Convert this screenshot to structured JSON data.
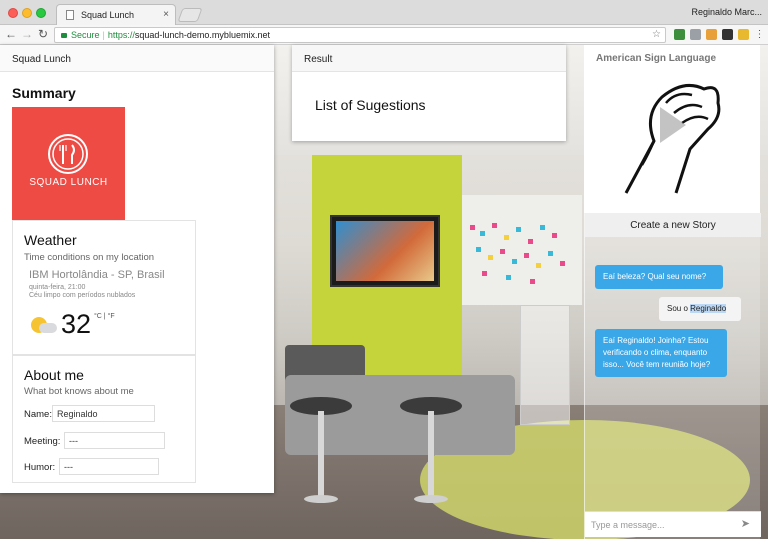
{
  "browser": {
    "tab_title": "Squad Lunch",
    "tab_close": "×",
    "profile_name": "Reginaldo Marc...",
    "secure_label": "Secure",
    "url_scheme": "https://",
    "url_host": "squad-lunch-demo.mybluemix.net",
    "back": "←",
    "forward": "→",
    "reload": "↻",
    "bookmark_star": "☆"
  },
  "left_panel": {
    "header": "Squad Lunch",
    "summary_title": "Summary",
    "logo_text": "SQUAD LUNCH",
    "weather": {
      "title": "Weather",
      "subtitle": "Time conditions on my location",
      "location": "IBM Hortolândia - SP, Brasil",
      "date": "quinta-feira, 21:00",
      "description": "Céu limpo com períodos nublados",
      "temperature": "32",
      "units": "°C | °F"
    },
    "about_me": {
      "title": "About me",
      "subtitle": "What bot knows about me",
      "name_label": "Name:",
      "name_value": "Reginaldo",
      "meeting_label": "Meeting:",
      "meeting_value": "---",
      "humor_label": "Humor:",
      "humor_value": "---"
    }
  },
  "result_panel": {
    "header": "Result",
    "body": "List of Sugestions"
  },
  "asl_panel": {
    "title": "American Sign Language"
  },
  "chat": {
    "header": "Create a new Story",
    "messages": [
      {
        "from": "bot",
        "text": "Eaí beleza? Qual seu nome?"
      },
      {
        "from": "user",
        "prefix": "Sou o ",
        "highlight": "Reginaldo"
      },
      {
        "from": "bot",
        "text": "Eaí Reginaldo! Joinha? Estou verificando o clima, enquanto isso... Você tem reunião hoje?"
      }
    ],
    "compose_placeholder": "Type a message...",
    "send_icon": "➤"
  },
  "colors": {
    "brand_red": "#ef4b45",
    "bot_bubble": "#3aa7e8",
    "secure_green": "#1e8e3e"
  }
}
